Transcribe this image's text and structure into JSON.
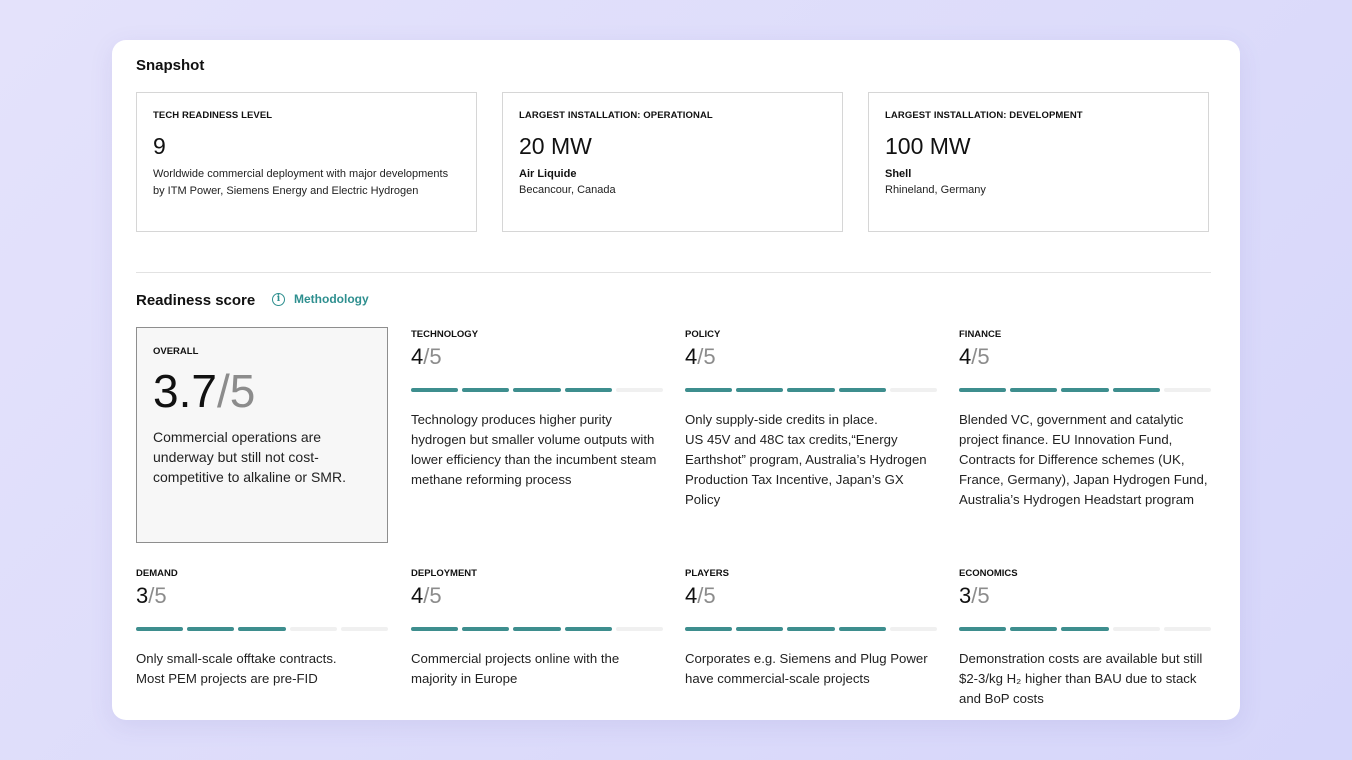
{
  "snapshot": {
    "title": "Snapshot",
    "tech": {
      "label": "TECH READINESS LEVEL",
      "value": "9",
      "desc": "Worldwide commercial deployment with major developments by ITM Power, Siemens Energy and Electric Hydrogen"
    },
    "operational": {
      "label": "LARGEST INSTALLATION: OPERATIONAL",
      "value": "20 MW",
      "name": "Air Liquide",
      "location": "Becancour, Canada"
    },
    "development": {
      "label": "LARGEST INSTALLATION: DEVELOPMENT",
      "value": "100 MW",
      "name": "Shell",
      "location": "Rhineland, Germany"
    }
  },
  "readiness": {
    "title": "Readiness score",
    "methodology_label": "Methodology",
    "info_icon": "info-icon",
    "overall": {
      "label": "OVERALL",
      "score": "3.7",
      "denominator": "/5",
      "desc": "Commercial operations are underway but still not cost-competitive to alkaline or SMR."
    },
    "accent_color": "#3e8e8e",
    "metrics": [
      {
        "label": "TECHNOLOGY",
        "score": "4",
        "denominator": "/5",
        "filled": 4,
        "segments": 5,
        "desc": "Technology produces higher purity hydrogen but smaller volume outputs with lower efficiency than the incumbent steam methane reforming process"
      },
      {
        "label": "POLICY",
        "score": "4",
        "denominator": "/5",
        "filled": 4,
        "segments": 5,
        "desc": "Only supply-side credits in place.\nUS 45V and 48C tax credits,“Energy Earthshot” program, Australia’s Hydrogen Production Tax Incentive, Japan’s GX Policy"
      },
      {
        "label": "FINANCE",
        "score": "4",
        "denominator": "/5",
        "filled": 4,
        "segments": 5,
        "desc": "Blended VC, government and catalytic project finance. EU Innovation Fund, Contracts for Difference schemes (UK, France, Germany), Japan Hydrogen Fund, Australia’s Hydrogen Headstart program"
      },
      {
        "label": "DEMAND",
        "score": "3",
        "denominator": "/5",
        "filled": 3,
        "segments": 5,
        "desc": "Only small-scale offtake contracts.\nMost PEM projects are pre-FID"
      },
      {
        "label": "DEPLOYMENT",
        "score": "4",
        "denominator": "/5",
        "filled": 4,
        "segments": 5,
        "desc": "Commercial projects online with the majority in Europe"
      },
      {
        "label": "PLAYERS",
        "score": "4",
        "denominator": "/5",
        "filled": 4,
        "segments": 5,
        "desc": "Corporates e.g. Siemens and Plug Power have commercial-scale projects"
      },
      {
        "label": "ECONOMICS",
        "score": "3",
        "denominator": "/5",
        "filled": 3,
        "segments": 5,
        "desc": "Demonstration costs are available but still $2-3/kg H₂ higher than BAU due to stack and BoP costs"
      }
    ]
  }
}
